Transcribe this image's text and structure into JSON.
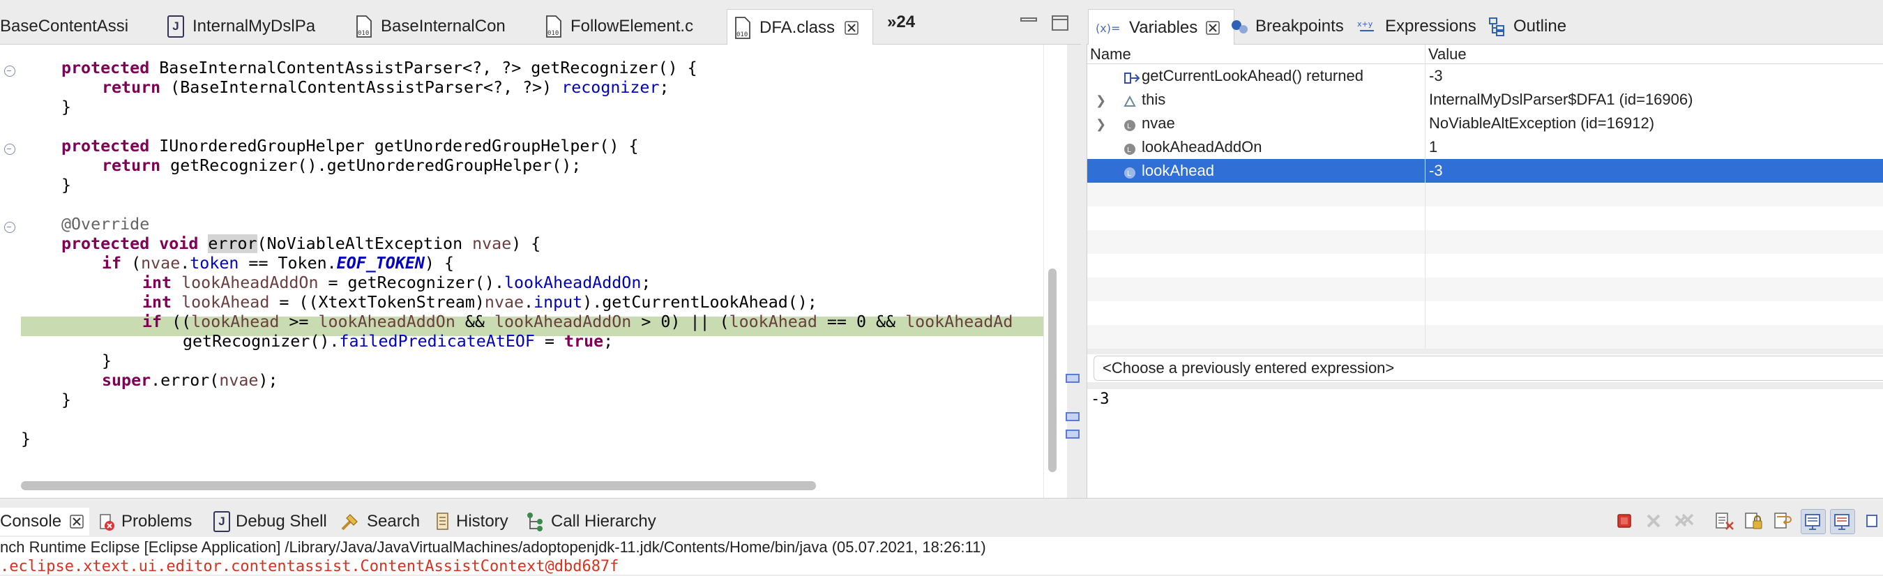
{
  "editor_tabs": [
    {
      "label": "BaseContentAssi",
      "icon": "class-file-icon"
    },
    {
      "label": "InternalMyDslPa",
      "icon": "java-file-icon"
    },
    {
      "label": "BaseInternalCon",
      "icon": "class-file-icon"
    },
    {
      "label": "FollowElement.c",
      "icon": "class-file-icon"
    },
    {
      "label": "DFA.class",
      "icon": "class-file-icon",
      "active": true
    }
  ],
  "editor_overflow": "»24",
  "code_lines": [
    {
      "text": "protected BaseInternalContentAssistParser<?, ?> getRecognizer() {"
    },
    {
      "text": "return (BaseInternalContentAssistParser<?, ?>) recognizer;"
    },
    {
      "text": "}"
    },
    {
      "text": ""
    },
    {
      "text": "protected IUnorderedGroupHelper getUnorderedGroupHelper() {"
    },
    {
      "text": "return getRecognizer().getUnorderedGroupHelper();"
    },
    {
      "text": "}"
    },
    {
      "text": ""
    },
    {
      "text": "@Override"
    },
    {
      "text": "protected void error(NoViableAltException nvae) {"
    },
    {
      "text": "if (nvae.token == Token.EOF_TOKEN) {"
    },
    {
      "text": "int lookAheadAddOn = getRecognizer().lookAheadAddOn;"
    },
    {
      "text": "int lookAhead = ((XtextTokenStream)nvae.input).getCurrentLookAhead();"
    },
    {
      "text": "if ((lookAhead >= lookAheadAddOn && lookAheadAddOn > 0) || (lookAhead == 0 && lookAheadAd"
    },
    {
      "text": "getRecognizer().failedPredicateAtEOF = true;"
    },
    {
      "text": "}"
    },
    {
      "text": "super.error(nvae);"
    },
    {
      "text": "}"
    },
    {
      "text": ""
    },
    {
      "text": "}"
    }
  ],
  "view_tabs": [
    {
      "label": "Variables",
      "icon": "variables-icon",
      "active": true
    },
    {
      "label": "Breakpoints",
      "icon": "breakpoints-icon"
    },
    {
      "label": "Expressions",
      "icon": "expressions-icon"
    },
    {
      "label": "Outline",
      "icon": "outline-icon"
    }
  ],
  "variables": {
    "columns": {
      "name": "Name",
      "value": "Value"
    },
    "rows": [
      {
        "name": "getCurrentLookAhead() returned",
        "value": "-3",
        "expandable": false,
        "icon": "method-result-icon"
      },
      {
        "name": "this",
        "value": "InternalMyDslParser$DFA1  (id=16906)",
        "expandable": true,
        "icon": "field-icon"
      },
      {
        "name": "nvae",
        "value": "NoViableAltException  (id=16912)",
        "expandable": true,
        "icon": "local-variable-icon"
      },
      {
        "name": "lookAheadAddOn",
        "value": "1",
        "expandable": false,
        "icon": "local-variable-icon"
      },
      {
        "name": "lookAhead",
        "value": "-3",
        "expandable": false,
        "icon": "local-variable-icon",
        "selected": true
      }
    ],
    "expression_placeholder": "<Choose a previously entered expression>",
    "detail_value": "-3"
  },
  "console_tabs": [
    {
      "label": "Console",
      "icon": "console-icon",
      "active": true
    },
    {
      "label": "Problems",
      "icon": "problems-icon"
    },
    {
      "label": "Debug Shell",
      "icon": "debug-shell-icon"
    },
    {
      "label": "Search",
      "icon": "search-icon"
    },
    {
      "label": "History",
      "icon": "history-icon"
    },
    {
      "label": "Call Hierarchy",
      "icon": "call-hierarchy-icon"
    }
  ],
  "console": {
    "launch_info": "nch Runtime Eclipse [Eclipse Application] /Library/Java/JavaVirtualMachines/adoptopenjdk-11.jdk/Contents/Home/bin/java  (05.07.2021, 18:26:11)",
    "output_line": ".eclipse.xtext.ui.editor.contentassist.ContentAssistContext@dbd687f"
  },
  "colors": {
    "selection": "#2f6fd6",
    "current_line": "#c9dcb1",
    "keyword": "#7f0055",
    "field": "#0000c0",
    "console_error": "#d9311f"
  }
}
